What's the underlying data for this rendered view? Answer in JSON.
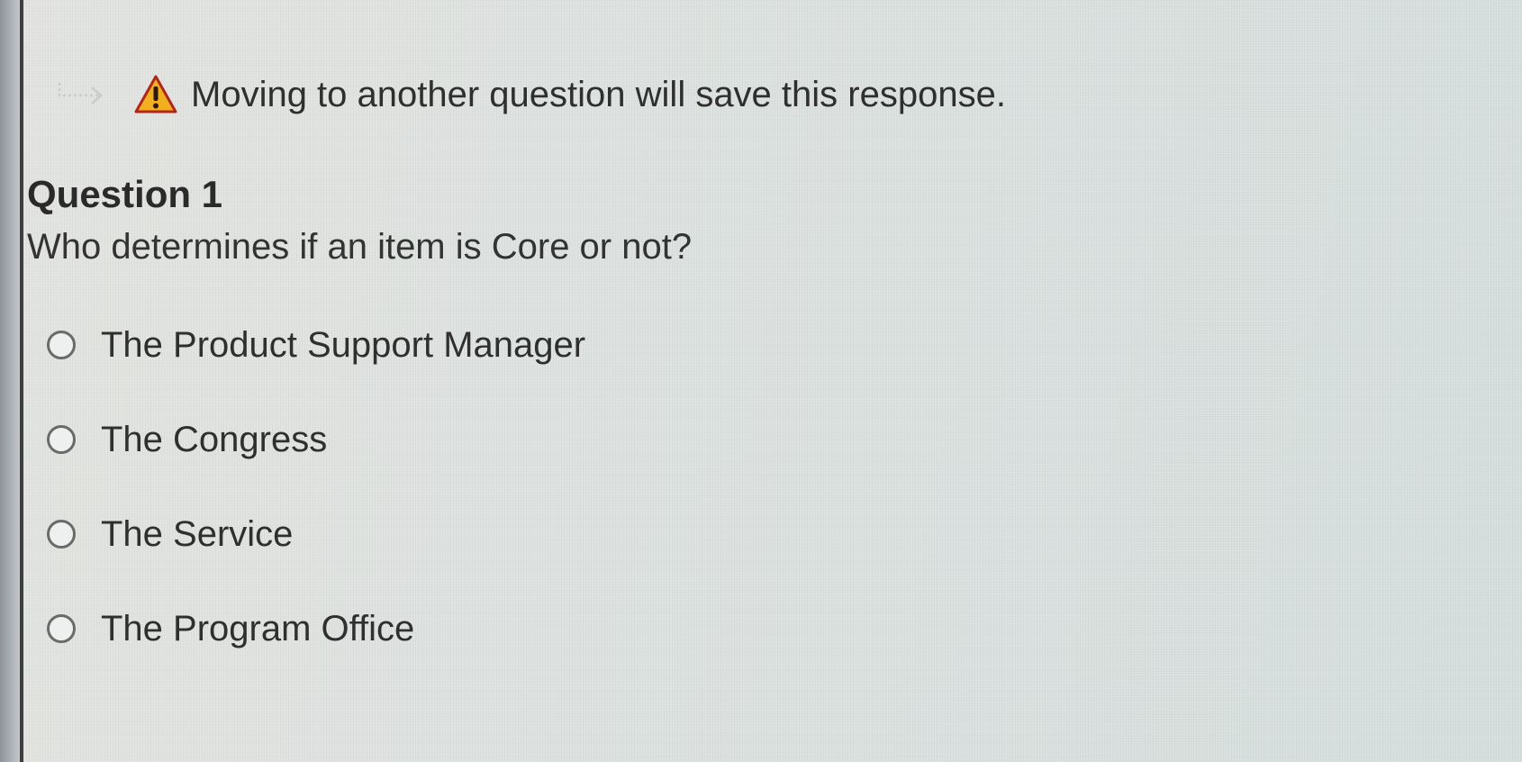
{
  "notice": {
    "icon": "warning-icon",
    "arrow_icon": "arrow-right-icon",
    "text": "Moving to another question will save this response."
  },
  "question": {
    "title": "Question 1",
    "text": "Who determines if an item is Core or not?",
    "options": [
      {
        "label": "The Product Support Manager",
        "selected": false
      },
      {
        "label": "The Congress",
        "selected": false
      },
      {
        "label": "The Service",
        "selected": false
      },
      {
        "label": "The Program Office",
        "selected": false
      }
    ]
  },
  "colors": {
    "warning_fill": "#f2b01e",
    "warning_stroke": "#b0261c"
  }
}
